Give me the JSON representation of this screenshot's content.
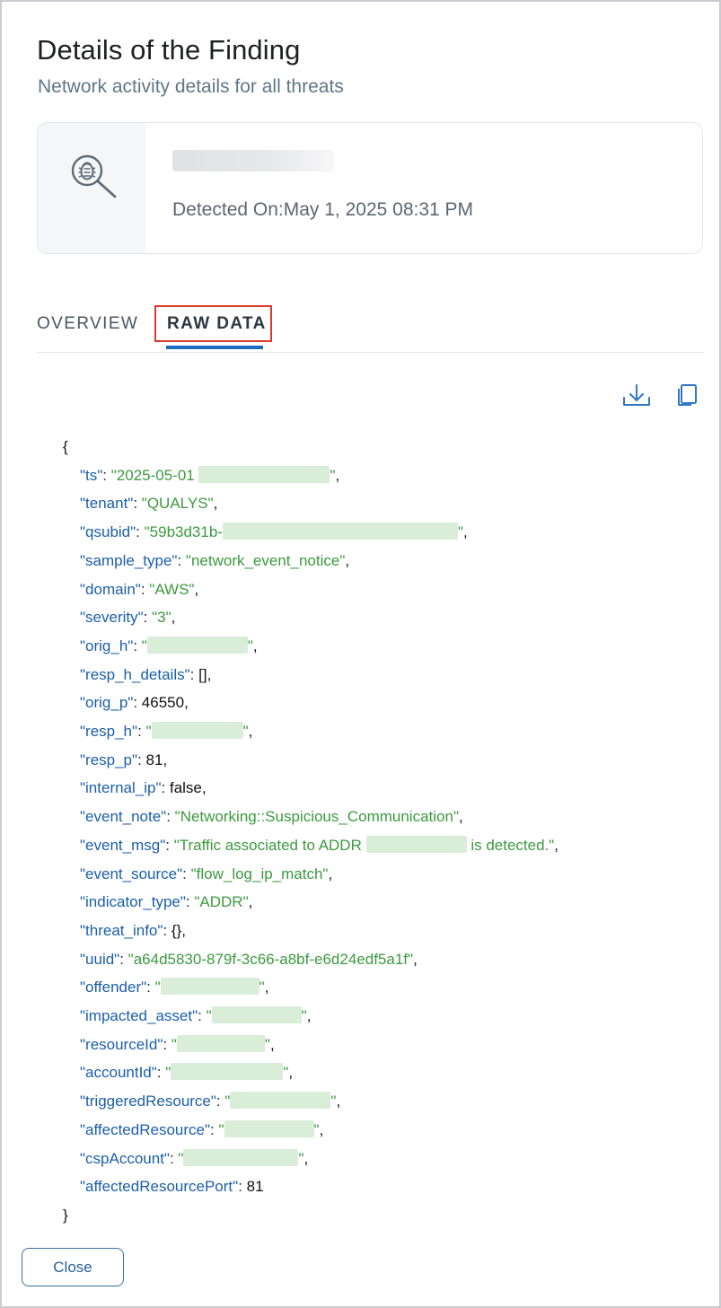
{
  "header": {
    "title": "Details of the Finding",
    "subtitle": "Network activity details for all threats"
  },
  "finding": {
    "detected_on": "Detected On:May 1, 2025 08:31 PM",
    "icon": "bug-search-icon"
  },
  "tabs": [
    {
      "label": "OVERVIEW",
      "active": false
    },
    {
      "label": "RAW DATA",
      "active": true
    }
  ],
  "toolbar": {
    "download_icon": "download-icon",
    "copy_icon": "copy-icon"
  },
  "raw_data": {
    "open_brace": "{",
    "close_brace": "}",
    "lines": [
      {
        "key": "\"ts\"",
        "parts": [
          {
            "t": "str",
            "v": "\"2025-05-01 "
          },
          {
            "t": "blur",
            "w": 146
          },
          {
            "t": "str",
            "v": "\""
          }
        ],
        "suffix": ","
      },
      {
        "key": "\"tenant\"",
        "parts": [
          {
            "t": "str",
            "v": "\"QUALYS\""
          }
        ],
        "suffix": ","
      },
      {
        "key": "\"qsubid\"",
        "parts": [
          {
            "t": "str",
            "v": "\"59b3d31b-"
          },
          {
            "t": "blur",
            "w": 262
          },
          {
            "t": "str",
            "v": "\""
          }
        ],
        "suffix": ","
      },
      {
        "key": "\"sample_type\"",
        "parts": [
          {
            "t": "str",
            "v": "\"network_event_notice\""
          }
        ],
        "suffix": ","
      },
      {
        "key": "\"domain\"",
        "parts": [
          {
            "t": "str",
            "v": "\"AWS\""
          }
        ],
        "suffix": ","
      },
      {
        "key": "\"severity\"",
        "parts": [
          {
            "t": "str",
            "v": "\"3\""
          }
        ],
        "suffix": ","
      },
      {
        "key": "\"orig_h\"",
        "parts": [
          {
            "t": "str",
            "v": "\""
          },
          {
            "t": "blur",
            "w": 112
          },
          {
            "t": "str",
            "v": "\""
          }
        ],
        "suffix": ","
      },
      {
        "key": "\"resp_h_details\"",
        "parts": [
          {
            "t": "plain",
            "v": "[]"
          }
        ],
        "suffix": ","
      },
      {
        "key": "\"orig_p\"",
        "parts": [
          {
            "t": "plain",
            "v": "46550"
          }
        ],
        "suffix": ","
      },
      {
        "key": "\"resp_h\"",
        "parts": [
          {
            "t": "str",
            "v": "\""
          },
          {
            "t": "blur",
            "w": 102
          },
          {
            "t": "str",
            "v": "\""
          }
        ],
        "suffix": ","
      },
      {
        "key": "\"resp_p\"",
        "parts": [
          {
            "t": "plain",
            "v": "81"
          }
        ],
        "suffix": ","
      },
      {
        "key": "\"internal_ip\"",
        "parts": [
          {
            "t": "plain",
            "v": "false"
          }
        ],
        "suffix": ","
      },
      {
        "key": "\"event_note\"",
        "parts": [
          {
            "t": "str",
            "v": "\"Networking::Suspicious_Communication\""
          }
        ],
        "suffix": ","
      },
      {
        "key": "\"event_msg\"",
        "parts": [
          {
            "t": "str",
            "v": "\"Traffic associated to ADDR "
          },
          {
            "t": "blur",
            "w": 112
          },
          {
            "t": "str",
            "v": " is detected.\""
          }
        ],
        "suffix": ","
      },
      {
        "key": "\"event_source\"",
        "parts": [
          {
            "t": "str",
            "v": "\"flow_log_ip_match\""
          }
        ],
        "suffix": ","
      },
      {
        "key": "\"indicator_type\"",
        "parts": [
          {
            "t": "str",
            "v": "\"ADDR\""
          }
        ],
        "suffix": ","
      },
      {
        "key": "\"threat_info\"",
        "parts": [
          {
            "t": "plain",
            "v": "{}"
          }
        ],
        "suffix": ","
      },
      {
        "key": "\"uuid\"",
        "parts": [
          {
            "t": "str",
            "v": "\"a64d5830-879f-3c66-a8bf-e6d24edf5a1f\""
          }
        ],
        "suffix": ","
      },
      {
        "key": "\"offender\"",
        "parts": [
          {
            "t": "str",
            "v": "\""
          },
          {
            "t": "blur",
            "w": 110
          },
          {
            "t": "str",
            "v": "\""
          }
        ],
        "suffix": ","
      },
      {
        "key": "\"impacted_asset\"",
        "parts": [
          {
            "t": "str",
            "v": "\""
          },
          {
            "t": "blur",
            "w": 100
          },
          {
            "t": "str",
            "v": "\""
          }
        ],
        "suffix": ","
      },
      {
        "key": "\"resourceId\"",
        "parts": [
          {
            "t": "str",
            "v": "\""
          },
          {
            "t": "blur",
            "w": 98
          },
          {
            "t": "str",
            "v": "\""
          }
        ],
        "suffix": ","
      },
      {
        "key": "\"accountId\"",
        "parts": [
          {
            "t": "str",
            "v": "\""
          },
          {
            "t": "blur",
            "w": 125
          },
          {
            "t": "str",
            "v": "\""
          }
        ],
        "suffix": ","
      },
      {
        "key": "\"triggeredResource\"",
        "parts": [
          {
            "t": "str",
            "v": "\""
          },
          {
            "t": "blur",
            "w": 112
          },
          {
            "t": "str",
            "v": "\""
          }
        ],
        "suffix": ","
      },
      {
        "key": "\"affectedResource\"",
        "parts": [
          {
            "t": "str",
            "v": "\""
          },
          {
            "t": "blur",
            "w": 100
          },
          {
            "t": "str",
            "v": "\""
          }
        ],
        "suffix": ","
      },
      {
        "key": "\"cspAccount\"",
        "parts": [
          {
            "t": "str",
            "v": "\""
          },
          {
            "t": "blur",
            "w": 128
          },
          {
            "t": "str",
            "v": "\""
          }
        ],
        "suffix": ","
      },
      {
        "key": "\"affectedResourcePort\"",
        "parts": [
          {
            "t": "plain",
            "v": "81"
          }
        ],
        "suffix": ""
      }
    ]
  },
  "footer": {
    "close_label": "Close"
  },
  "colors": {
    "accent": "#1d6cc0",
    "highlight_box": "#d93a30",
    "json_key": "#1b5fa8",
    "json_string": "#3c9a3e"
  }
}
